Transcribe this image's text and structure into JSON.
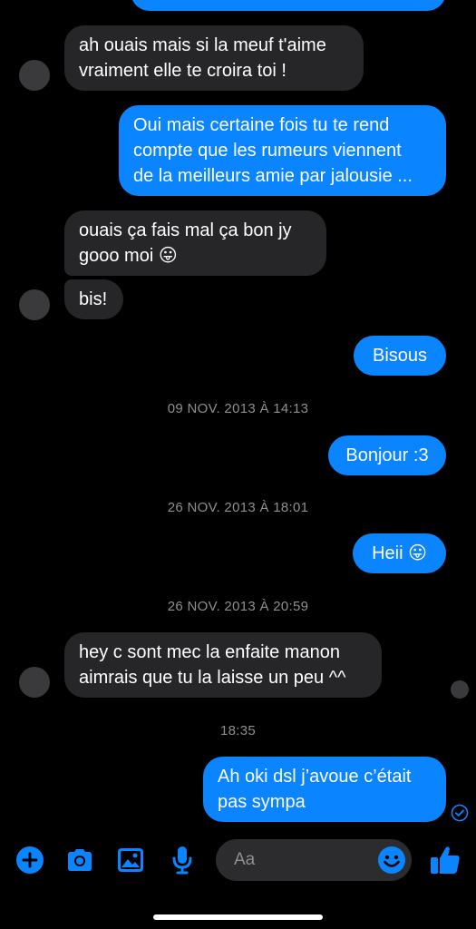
{
  "conversation": {
    "messages": [
      {
        "side": "in",
        "text": "ah ouais mais si la meuf t'aime\nvraiment elle te croira toi !"
      },
      {
        "side": "out",
        "text": "Oui mais certaine fois tu te rend\ncompte que les rumeurs viennent\nde la meilleurs amie par jalousie ..."
      },
      {
        "side": "in",
        "text": "ouais ça fais mal ça bon jy\ngooo moi 😛"
      },
      {
        "side": "in",
        "text": "bis!"
      },
      {
        "side": "out",
        "text": "Bisous"
      },
      {
        "side": "out",
        "text": "Bonjour :3"
      },
      {
        "side": "out",
        "text": "Heii 😛"
      },
      {
        "side": "in",
        "text": "hey c sont mec la enfaite manon\naimrais que tu la laisse un peu ^^"
      },
      {
        "side": "out",
        "text": "Ah oki dsl j’avoue c’était\npas sympa"
      }
    ],
    "timestamps": [
      "09 NOV. 2013 À 14:13",
      "26 NOV. 2013 À 18:01",
      "26 NOV. 2013 À 20:59",
      "18:35"
    ]
  },
  "composer": {
    "placeholder": "Aa",
    "icons": [
      "plus-icon",
      "camera-icon",
      "image-icon",
      "microphone-icon",
      "emoji-icon",
      "thumbs-up-icon"
    ]
  },
  "colors": {
    "accent": "#0a84ff",
    "incoming_bubble": "#262628",
    "background": "#000000",
    "timestamp": "#8e8e93"
  }
}
